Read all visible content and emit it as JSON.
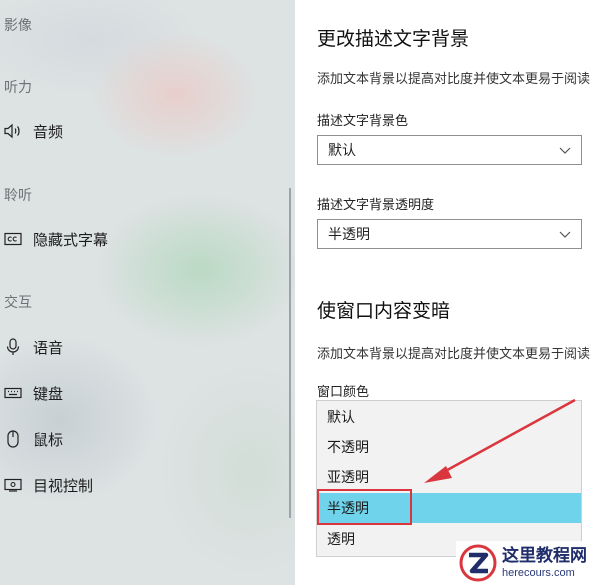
{
  "sidebar": {
    "top_partial": "影像",
    "sections": [
      {
        "header": "听力",
        "items": [
          {
            "label": "音频",
            "icon": "speaker-icon"
          }
        ]
      },
      {
        "header": "聆听",
        "items": [
          {
            "label": "隐藏式字幕",
            "icon": "closed-caption-icon"
          }
        ]
      },
      {
        "header": "交互",
        "items": [
          {
            "label": "语音",
            "icon": "microphone-icon"
          },
          {
            "label": "键盘",
            "icon": "keyboard-icon"
          },
          {
            "label": "鼠标",
            "icon": "mouse-icon"
          },
          {
            "label": "目视控制",
            "icon": "eye-control-icon"
          }
        ]
      }
    ]
  },
  "content": {
    "section1": {
      "title": "更改描述文字背景",
      "description": "添加文本背景以提高对比度并使文本更易于阅读",
      "fields": [
        {
          "label": "描述文字背景色",
          "value": "默认"
        },
        {
          "label": "描述文字背景透明度",
          "value": "半透明"
        }
      ]
    },
    "section2": {
      "title": "使窗口内容变暗",
      "description": "添加文本背景以提高对比度并使文本更易于阅读",
      "field_label": "窗口颜色",
      "dropdown_options": [
        "默认",
        "不透明",
        "亚透明",
        "半透明",
        "透明"
      ],
      "selected_option": "半透明"
    }
  },
  "annotation": {
    "arrow_color": "#d9363e",
    "box_color": "#d9363e"
  },
  "watermark": {
    "title": "这里教程网",
    "url": "herecours.com"
  },
  "colors": {
    "selection": "#6fd3eb",
    "accent_red": "#d9363e"
  }
}
